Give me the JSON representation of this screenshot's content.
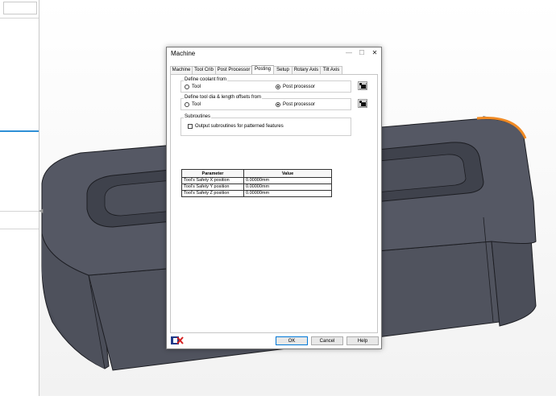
{
  "dialog": {
    "title": "Machine",
    "tabs": [
      "Machine",
      "Tool Crib",
      "Post Processor",
      "Posting",
      "Setup",
      "Rotary Axis",
      "Tilt Axis"
    ],
    "active_tab": "Posting",
    "coolant": {
      "label": "Define coolant from",
      "option_tool": "Tool",
      "option_post": "Post processor",
      "selected": "Post processor"
    },
    "offsets": {
      "label": "Define tool dia & length offsets from",
      "option_tool": "Tool",
      "option_post": "Post processor",
      "selected": "Post processor"
    },
    "subroutines": {
      "label": "Subroutines",
      "checkbox_label": "Output subroutines for patterned features",
      "checked": false
    },
    "table": {
      "headers": [
        "Parameter",
        "Value"
      ],
      "rows": [
        [
          "Tool's Safety X position",
          "0.00000mm"
        ],
        [
          "Tool's Safety Y position",
          "0.00000mm"
        ],
        [
          "Tool's Safety Z position",
          "0.00000mm"
        ]
      ]
    },
    "buttons": {
      "ok": "OK",
      "cancel": "Cancel",
      "help": "Help"
    }
  },
  "colors": {
    "model_fill": "#4f525d",
    "model_edge": "#1c1d22",
    "highlight": "#f08a24",
    "accent": "#2e8fd6"
  }
}
